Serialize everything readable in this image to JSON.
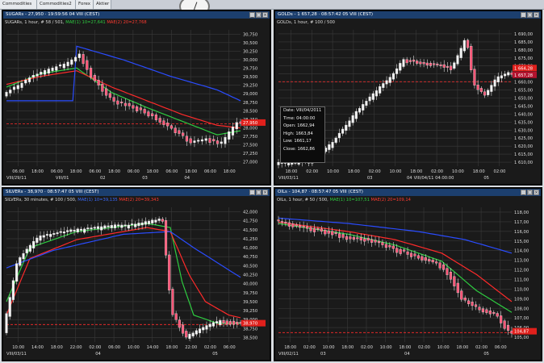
{
  "tabs": [
    "Commodities",
    "Commodities2",
    "Forex",
    "Aktier"
  ],
  "panels": {
    "sugar": {
      "title": "SUGARs - 27,950 · 19:59:56 04 VIII (CEST)",
      "info": {
        "prefix": "SUGARs, 1 hour, # 58 / 501,",
        "ma1": "MAE(1) 10=27,641",
        "ma2": "MAE(2) 20=27,768"
      },
      "y_ticks": [
        "30,750",
        "30,500",
        "30,250",
        "30,000",
        "29,750",
        "29,500",
        "29,250",
        "29,000",
        "28,750",
        "28,500",
        "28,250",
        "28,000",
        "27,750",
        "27,500",
        "27,250",
        "27,000"
      ],
      "last_price": "27,950",
      "x_ticks": [
        "06:00",
        "18:00",
        "06:00",
        "18:00",
        "06:00",
        "18:00",
        "06:00",
        "18:00",
        "06:00",
        "18:00",
        "06:00",
        "18:00"
      ],
      "date_labels": [
        "VIII/29/11",
        "VIII/01",
        "02",
        "03",
        "04"
      ]
    },
    "gold": {
      "title": "GOLDs - 1 657,28 · 08:57:42 05 VIII (CEST)",
      "info": {
        "prefix": "GOLDs, 1 hour, # 100 / 500"
      },
      "y_ticks": [
        "1 690,00",
        "1 685,00",
        "1 680,00",
        "1 675,00",
        "1 670,00",
        "1 665,00",
        "1 660,00",
        "1 655,00",
        "1 650,00",
        "1 645,00",
        "1 640,00",
        "1 635,00",
        "1 630,00",
        "1 625,00",
        "1 620,00",
        "1 615,00",
        "1 610,00"
      ],
      "last_price": "1 664,28",
      "ref_price": "1 657,28",
      "x_ticks": [
        "18:00",
        "02:00",
        "10:00",
        "18:00",
        "02:00",
        "10:00",
        "18:00",
        "02:00",
        "10:00",
        "18:00",
        "02:00"
      ],
      "date_labels": [
        "VIII/03/11",
        "03",
        "04",
        "VIII/04/11 04:00:00",
        "05"
      ],
      "tooltip": [
        [
          "Date:",
          "VIII/04/2011"
        ],
        [
          "Time:",
          "04:00:00"
        ],
        [
          "Open:",
          "1662,94"
        ],
        [
          "High:",
          "1663,84"
        ],
        [
          "Low:",
          "1661,17"
        ],
        [
          "Close:",
          "1662,86"
        ]
      ]
    },
    "silver": {
      "title": "SILVERs - 38,970 · 08:57:47 05 VIII (CEST)",
      "info": {
        "prefix": "SILVERs, 30 minutes, # 100 / 500,",
        "ma1": "MAE(1) 10=39,135",
        "ma2": "MAE(2) 20=39,343"
      },
      "y_ticks": [
        "42,000",
        "41,750",
        "41,500",
        "41,250",
        "41,000",
        "40,750",
        "40,500",
        "40,250",
        "40,000",
        "39,750",
        "39,500",
        "39,250",
        "39,000",
        "38,750",
        "38,500"
      ],
      "last_price": "38,970",
      "x_ticks": [
        "10:00",
        "14:00",
        "18:00",
        "22:00",
        "02:00",
        "06:00",
        "10:00",
        "14:00",
        "18:00",
        "22:00",
        "02:00",
        "06:00"
      ],
      "date_labels": [
        "VIII/03/11",
        "04",
        "05"
      ]
    },
    "oil": {
      "title": "OILs - 104,87 · 08:57:47 05 VIII (CEST)",
      "info": {
        "prefix": "OILs, 1 hour, # 50 / 500,",
        "ma1": "MAE(1) 10=107,51",
        "ma2": "MAE(2) 20=109,14"
      },
      "y_ticks": [
        "118,00",
        "117,00",
        "116,00",
        "115,00",
        "114,00",
        "113,00",
        "112,00",
        "111,00",
        "110,00",
        "109,00",
        "108,00",
        "107,00",
        "106,00",
        "105,00"
      ],
      "last_price": "104,87",
      "x_ticks": [
        "18:00",
        "02:00",
        "10:00",
        "18:00",
        "02:00",
        "10:00",
        "18:00",
        "02:00",
        "10:00",
        "18:00",
        "02:00",
        "06:00"
      ],
      "date_labels": [
        "VIII/02/11",
        "03",
        "04",
        "05"
      ]
    }
  },
  "colors": {
    "ma_short": "#2ecc40",
    "ma_long": "#ff2a2a",
    "ma_slow": "#2a4cff",
    "candle_up": "#f2f2f2",
    "candle_down": "#ff5577",
    "ref_line": "#ff2a2a",
    "bg": "#1a1a1a"
  }
}
